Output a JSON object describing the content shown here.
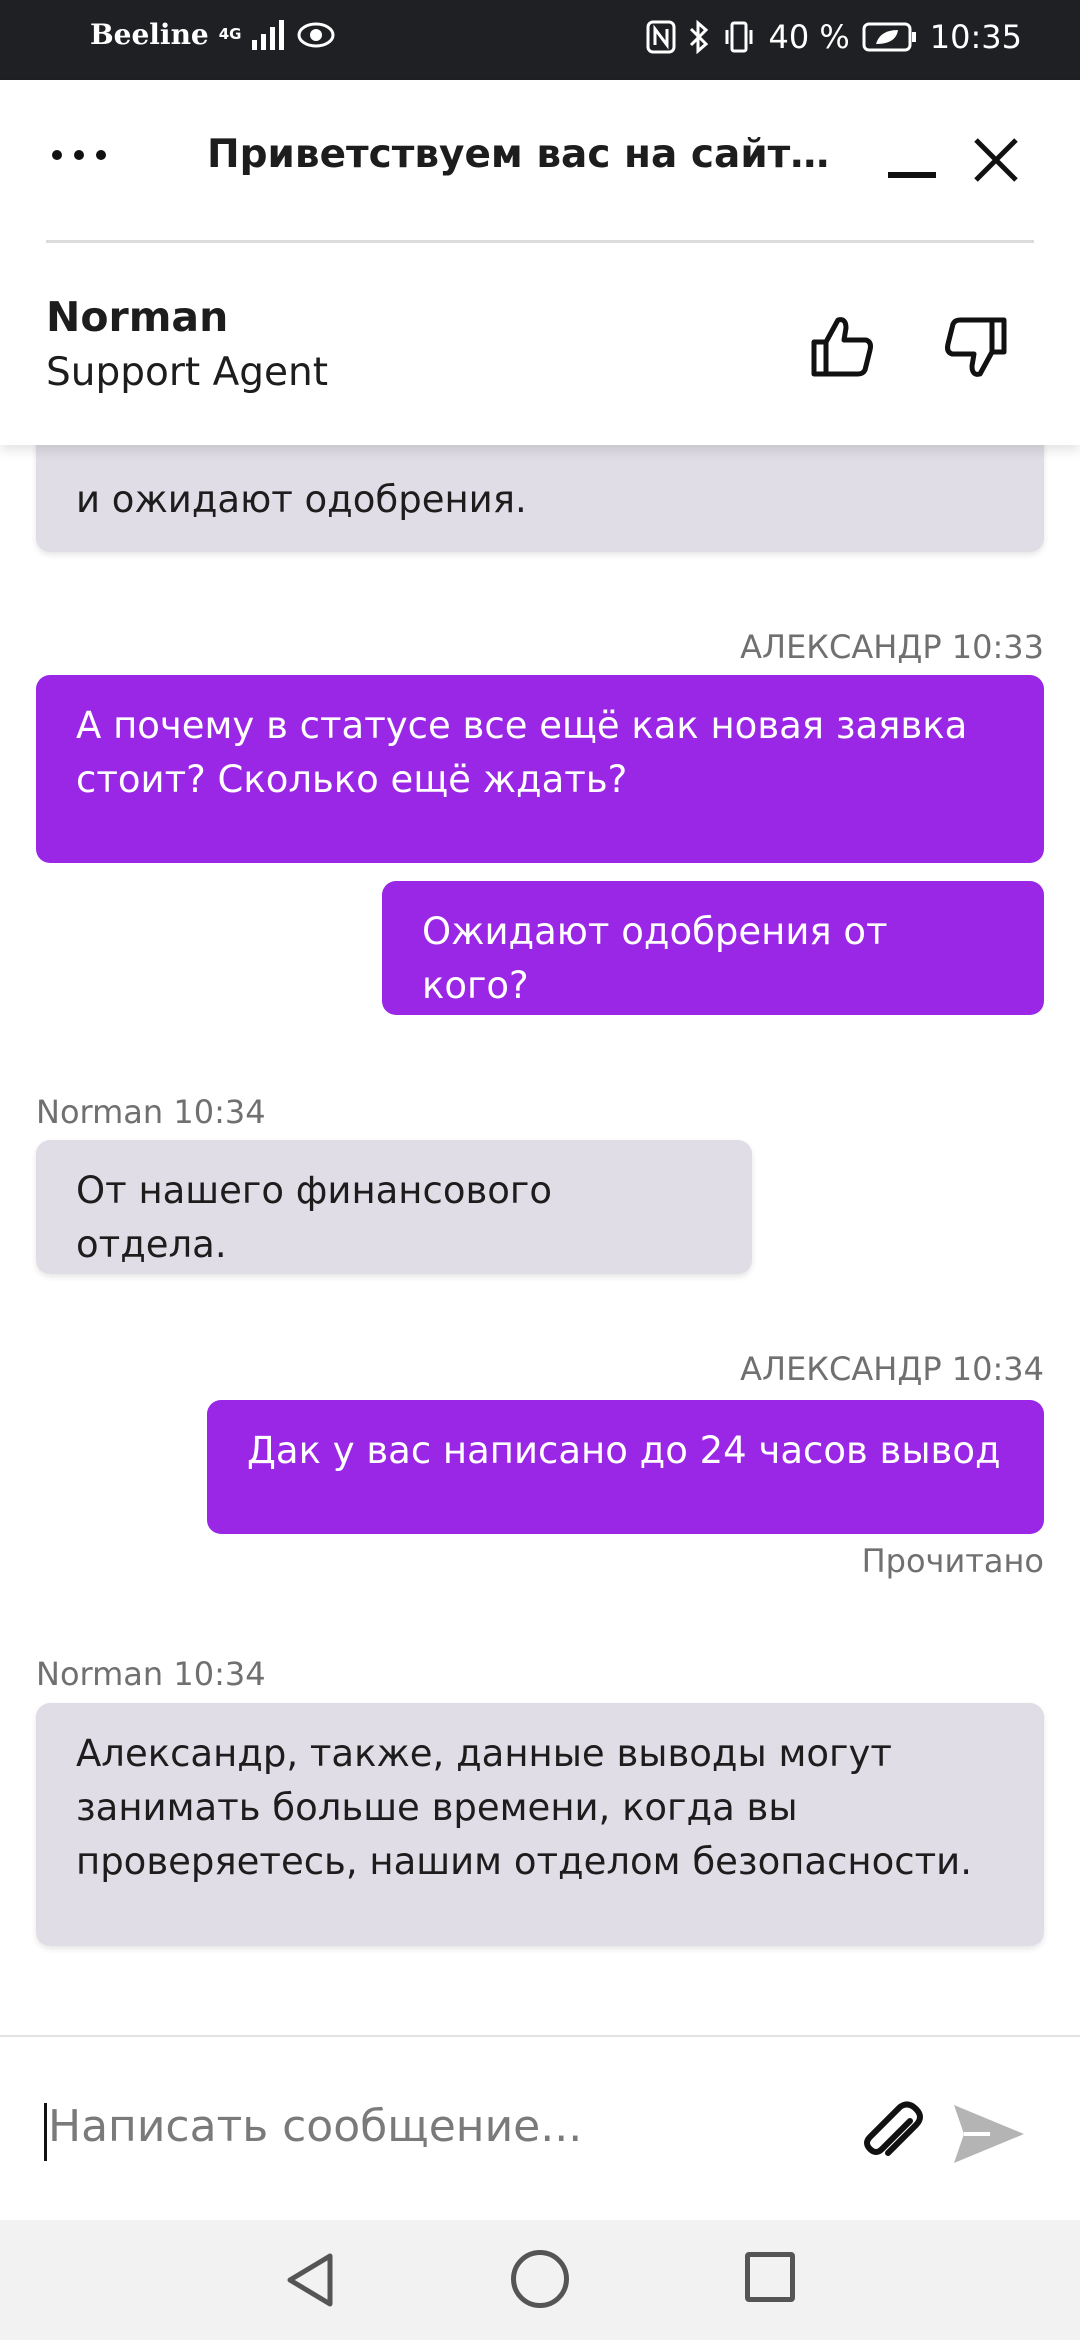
{
  "status_bar": {
    "carrier": "Beeline",
    "network": "4G",
    "battery_percent": "40 %",
    "time": "10:35"
  },
  "header": {
    "title": "Приветствуем вас на сайте ...",
    "agent_name": "Norman",
    "agent_role": "Support Agent"
  },
  "messages": [
    {
      "from": "agent",
      "text": "и ожидают одобрения."
    },
    {
      "from": "user",
      "meta": "АЛЕКСАНДР 10:33",
      "text": "А почему в статусе все ещё как новая заявка стоит? Сколько ещё ждать?"
    },
    {
      "from": "user",
      "text": "Ожидают одобрения от кого?"
    },
    {
      "from": "agent",
      "meta": "Norman 10:34",
      "text": "От нашего финансового отдела."
    },
    {
      "from": "user",
      "meta": "АЛЕКСАНДР 10:34",
      "text": "Дак у вас написано до 24 часов вывод",
      "receipt": "Прочитано"
    },
    {
      "from": "agent",
      "meta": "Norman 10:34",
      "text": "Александр, также, данные выводы могут занимать больше времени, когда вы проверяетесь, нашим отделом безопасности."
    }
  ],
  "input": {
    "placeholder": "Написать сообщение..."
  },
  "colors": {
    "user_bubble": "#9a26e6",
    "agent_bubble": "#e1dde6"
  }
}
